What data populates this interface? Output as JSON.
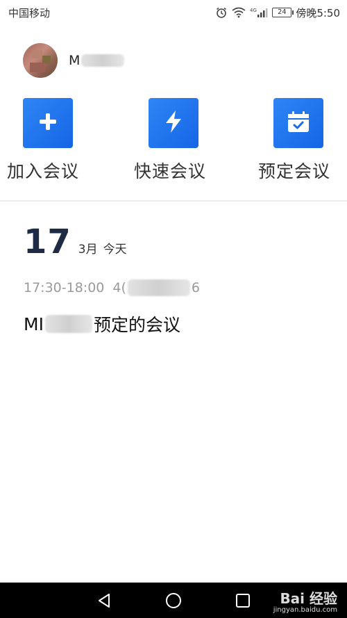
{
  "status_bar": {
    "carrier": "中国移动",
    "network": "4G",
    "battery": "24",
    "time": "傍晚5:50"
  },
  "user": {
    "name": "M"
  },
  "actions": [
    {
      "label": "加入会议",
      "icon": "plus-icon"
    },
    {
      "label": "快速会议",
      "icon": "lightning-icon"
    },
    {
      "label": "预定会议",
      "icon": "calendar-check-icon"
    }
  ],
  "schedule": {
    "day": "17",
    "month": "3月",
    "today": "今天"
  },
  "meeting": {
    "time": "17:30-18:00",
    "id_prefix": "4(",
    "id_suffix": "6",
    "title_prefix": "MI",
    "title_suffix": "预定的会议"
  },
  "watermark": {
    "brand": "Bai 经验",
    "sub": "jingyan.baidu.com"
  },
  "colors": {
    "accent": "#1a6cea",
    "day_text": "#1f2a44",
    "muted": "#9a9a9a"
  }
}
